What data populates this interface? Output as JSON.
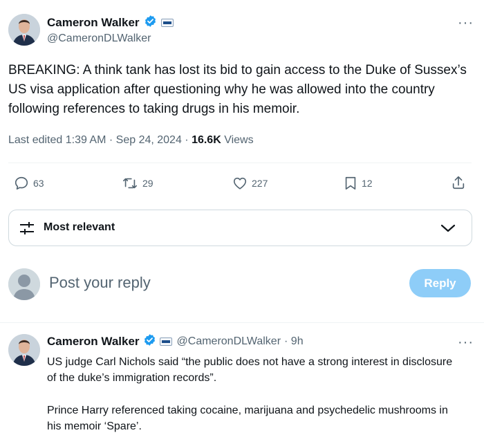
{
  "main_tweet": {
    "author_name": "Cameron Walker",
    "author_handle": "@CameronDLWalker",
    "more_label": "···",
    "text": "BREAKING: A think tank has lost its bid to gain access to the Duke of Sussex’s US visa application after questioning why he was allowed into the country following references to taking drugs in his memoir.",
    "edited_label": "Last edited 1:39 AM · Sep 24, 2024 · ",
    "views_count": "16.6K",
    "views_label": " Views"
  },
  "actions": {
    "replies": "63",
    "reposts": "29",
    "likes": "227",
    "bookmarks": "12"
  },
  "sort": {
    "label": "Most relevant"
  },
  "composer": {
    "placeholder": "Post your reply",
    "reply_button": "Reply"
  },
  "reply_tweet": {
    "author_name": "Cameron Walker",
    "author_handle": "@CameronDLWalker",
    "time": " · 9h",
    "more_label": "···",
    "paragraph1": "US judge Carl Nichols said “the public does not have a strong interest in disclosure of the duke’s immigration records”.",
    "paragraph2": "Prince Harry referenced taking cocaine, marijuana and psychedelic mushrooms in his memoir ‘Spare’."
  },
  "colors": {
    "verified": "#1d9bf0",
    "secondary_text": "#536471",
    "reply_button_bg": "#8ecdf8"
  }
}
